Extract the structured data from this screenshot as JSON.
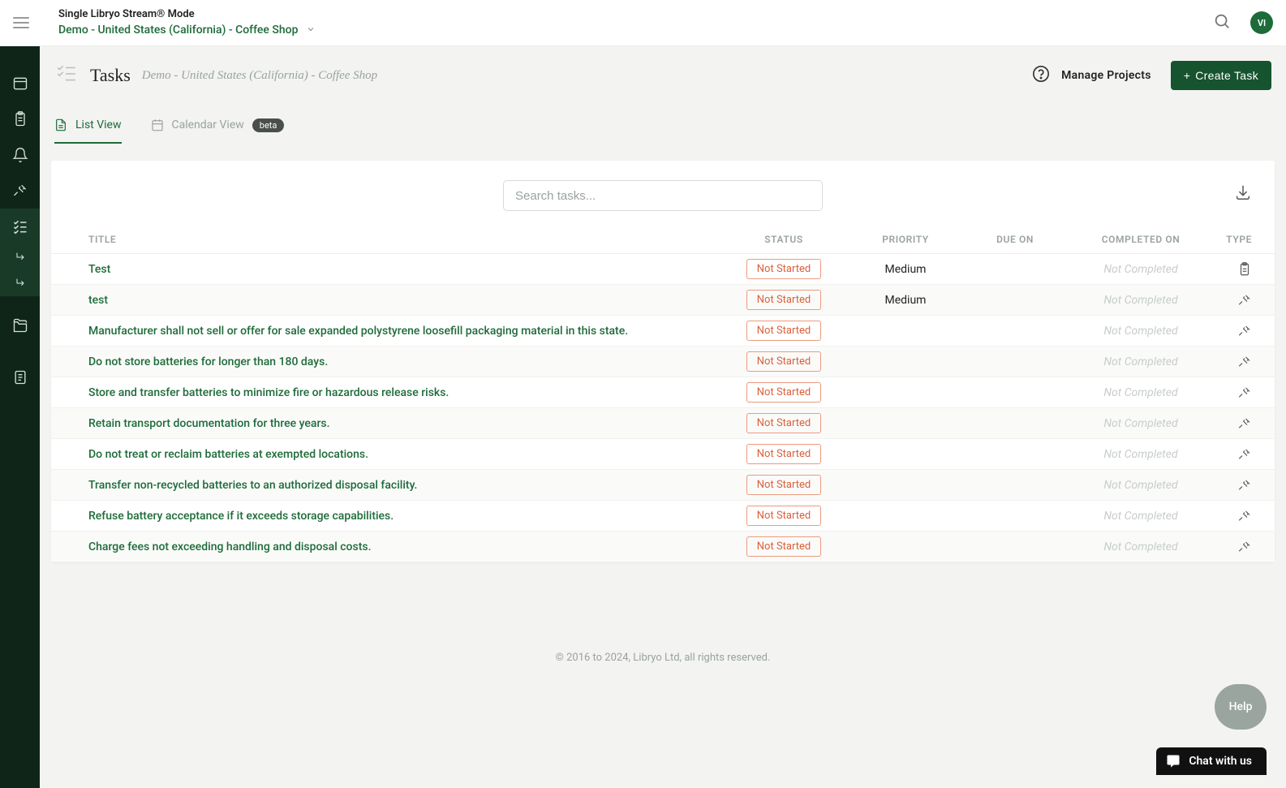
{
  "header": {
    "mode": "Single Libryo Stream® Mode",
    "context": "Demo - United States (California) - Coffee Shop",
    "avatar_initials": "VI"
  },
  "page": {
    "title": "Tasks",
    "subtitle": "Demo - United States (California) - Coffee Shop",
    "manage_projects": "Manage Projects",
    "create_task": "Create Task"
  },
  "tabs": {
    "list": "List View",
    "calendar": "Calendar View",
    "beta": "beta"
  },
  "search": {
    "placeholder": "Search tasks..."
  },
  "table": {
    "headers": {
      "title": "TITLE",
      "status": "STATUS",
      "priority": "PRIORITY",
      "due_on": "DUE ON",
      "completed_on": "COMPLETED ON",
      "type": "TYPE"
    },
    "not_completed": "Not Completed",
    "status_not_started": "Not Started",
    "rows": [
      {
        "title": "Test",
        "status": "Not Started",
        "priority": "Medium",
        "due": "",
        "completed": "Not Completed",
        "type_icon": "clipboard"
      },
      {
        "title": "test",
        "status": "Not Started",
        "priority": "Medium",
        "due": "",
        "completed": "Not Completed",
        "type_icon": "gavel"
      },
      {
        "title": "Manufacturer shall not sell or offer for sale expanded polystyrene loosefill packaging material in this state.",
        "status": "Not Started",
        "priority": "",
        "due": "",
        "completed": "Not Completed",
        "type_icon": "gavel"
      },
      {
        "title": "Do not store batteries for longer than 180 days.",
        "status": "Not Started",
        "priority": "",
        "due": "",
        "completed": "Not Completed",
        "type_icon": "gavel"
      },
      {
        "title": "Store and transfer batteries to minimize fire or hazardous release risks.",
        "status": "Not Started",
        "priority": "",
        "due": "",
        "completed": "Not Completed",
        "type_icon": "gavel"
      },
      {
        "title": "Retain transport documentation for three years.",
        "status": "Not Started",
        "priority": "",
        "due": "",
        "completed": "Not Completed",
        "type_icon": "gavel"
      },
      {
        "title": "Do not treat or reclaim batteries at exempted locations.",
        "status": "Not Started",
        "priority": "",
        "due": "",
        "completed": "Not Completed",
        "type_icon": "gavel"
      },
      {
        "title": "Transfer non-recycled batteries to an authorized disposal facility.",
        "status": "Not Started",
        "priority": "",
        "due": "",
        "completed": "Not Completed",
        "type_icon": "gavel"
      },
      {
        "title": "Refuse battery acceptance if it exceeds storage capabilities.",
        "status": "Not Started",
        "priority": "",
        "due": "",
        "completed": "Not Completed",
        "type_icon": "gavel"
      },
      {
        "title": "Charge fees not exceeding handling and disposal costs.",
        "status": "Not Started",
        "priority": "",
        "due": "",
        "completed": "Not Completed",
        "type_icon": "gavel"
      }
    ]
  },
  "footer": "© 2016 to 2024, Libryo Ltd, all rights reserved.",
  "help_fab": "Help",
  "chat": "Chat with us"
}
